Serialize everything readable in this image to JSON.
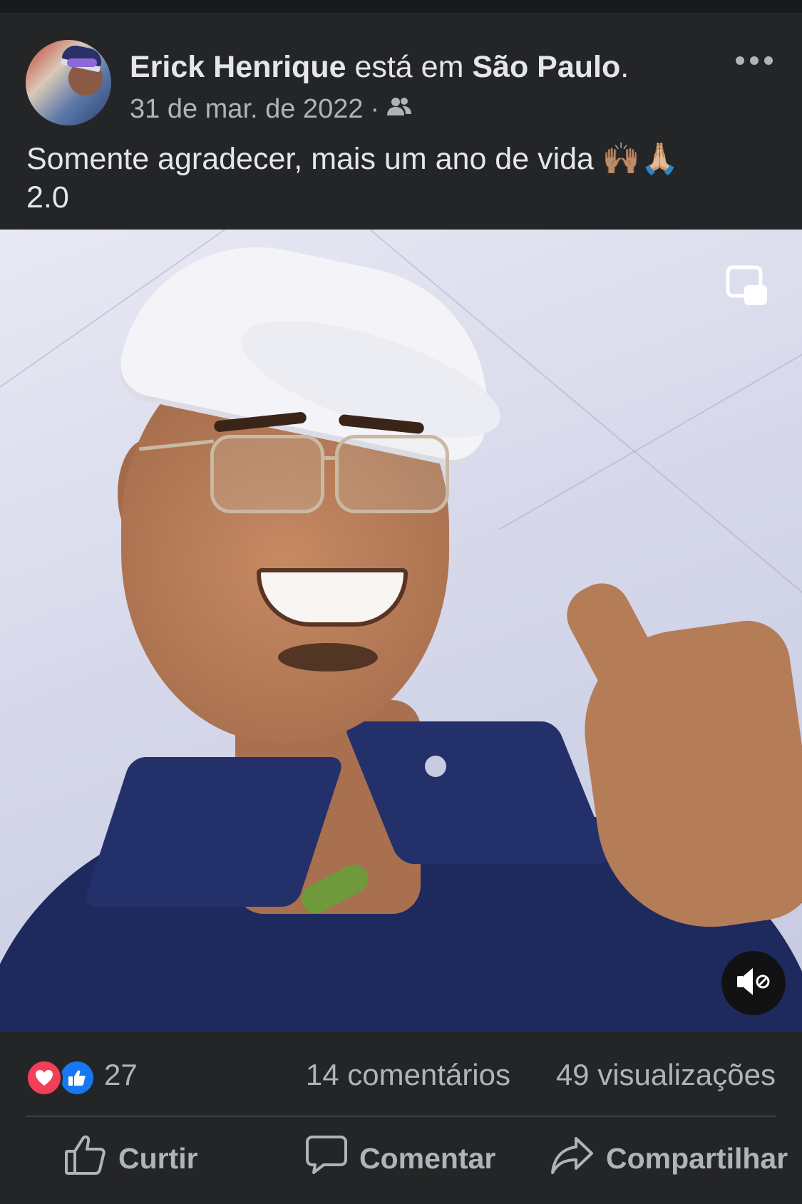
{
  "post": {
    "author_name": "Erick Henrique",
    "connector": " está em ",
    "location": "São Paulo",
    "location_suffix": ".",
    "date": "31 de mar. de 2022",
    "separator": "·",
    "audience_icon": "friends-icon",
    "text": "Somente agradecer, mais um ano de vida 🙌🏽🙏🏼\n2.0"
  },
  "media": {
    "type": "video",
    "pip_icon": "picture-in-picture-icon",
    "sound_icon": "muted-speaker-icon"
  },
  "stats": {
    "reactions": [
      "love",
      "like"
    ],
    "reaction_count": "27",
    "comments": "14 comentários",
    "views": "49 visualizações"
  },
  "actions": {
    "like_label": "Curtir",
    "comment_label": "Comentar",
    "share_label": "Compartilhar"
  },
  "colors": {
    "background": "#242526",
    "text_primary": "#e4e6eb",
    "text_secondary": "#b0b3b8",
    "love": "#f33e58",
    "like": "#1877f2"
  }
}
